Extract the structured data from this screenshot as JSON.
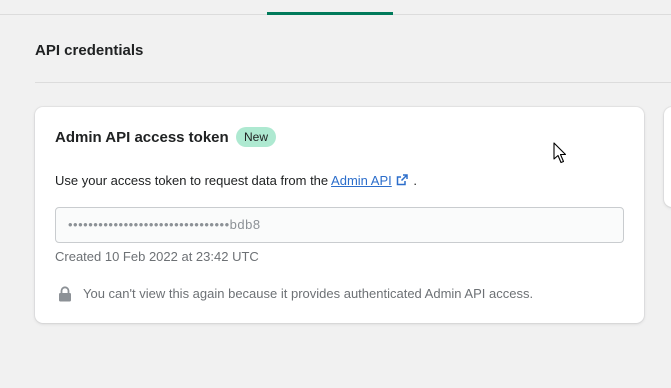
{
  "tabs": {
    "active_color": "#007a5a"
  },
  "section": {
    "title": "API credentials"
  },
  "card": {
    "title": "Admin API access token",
    "badge": "New",
    "description_prefix": "Use your access token to request data from the",
    "link_text": "Admin API",
    "description_suffix": ".",
    "token_value": "••••••••••••••••••••••••••••••••bdb8",
    "created": "Created 10 Feb 2022 at 23:42 UTC",
    "notice": "You can't view this again because it provides authenticated Admin API access."
  },
  "icons": {
    "external": "external-link-icon",
    "lock": "lock-icon",
    "cursor": "mouse-pointer-icon"
  },
  "colors": {
    "accent": "#007a5a",
    "badge_bg": "#aee9d1",
    "link": "#2c6ecb"
  }
}
